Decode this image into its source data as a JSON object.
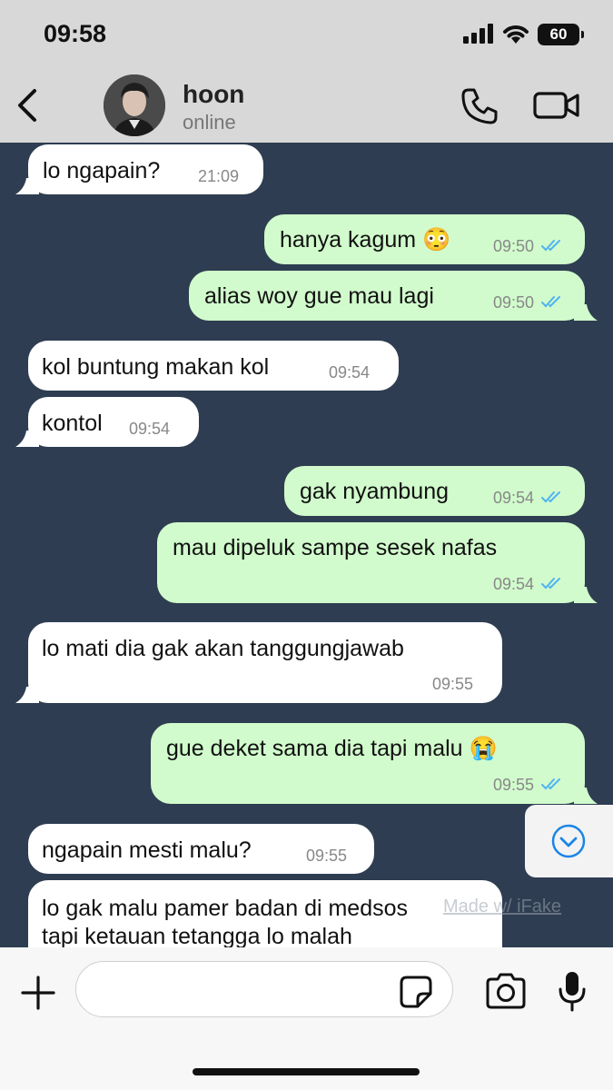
{
  "status_bar": {
    "time": "09:58",
    "battery": "60"
  },
  "header": {
    "contact_name": "hoon",
    "contact_status": "online",
    "back_icon": "chevron-left-icon",
    "call_icon": "phone-icon",
    "video_icon": "video-camera-icon"
  },
  "messages": [
    {
      "direction": "in",
      "text": "lo ngapain?",
      "time": "21:09"
    },
    {
      "direction": "out",
      "text": "hanya kagum 😳",
      "time": "09:50",
      "status": "read"
    },
    {
      "direction": "out",
      "text": "alias woy gue mau lagi",
      "time": "09:50",
      "status": "read"
    },
    {
      "direction": "in",
      "text": "kol buntung makan kol",
      "time": "09:54"
    },
    {
      "direction": "in",
      "text": "kontol",
      "time": "09:54"
    },
    {
      "direction": "out",
      "text": "gak nyambung",
      "time": "09:54",
      "status": "read"
    },
    {
      "direction": "out",
      "text": "mau dipeluk sampe sesek nafas",
      "time": "09:54",
      "status": "read"
    },
    {
      "direction": "in",
      "text": "lo mati dia gak akan tanggungjawab",
      "time": "09:55"
    },
    {
      "direction": "out",
      "text": "gue deket sama dia tapi malu 😭",
      "time": "09:55",
      "status": "read"
    },
    {
      "direction": "in",
      "text": "ngapain mesti malu?",
      "time": "09:55"
    },
    {
      "direction": "in",
      "text_lines": [
        "lo gak malu pamer badan di medsos",
        "tapi ketauan tetangga lo malah"
      ]
    }
  ],
  "watermark": "Made w/ iFake",
  "colors": {
    "chat_background": "#2e3d51",
    "incoming_bubble": "#ffffff",
    "outgoing_bubble": "#d1fbcc",
    "read_ticks": "#4fb3f2",
    "header_background": "#d8d8d8"
  },
  "input_bar": {
    "placeholder": "",
    "plus_icon": "plus-icon",
    "sticker_icon": "sticker-icon",
    "camera_icon": "camera-icon",
    "mic_icon": "microphone-icon"
  },
  "scroll_button_icon": "chevron-down-circle-icon"
}
